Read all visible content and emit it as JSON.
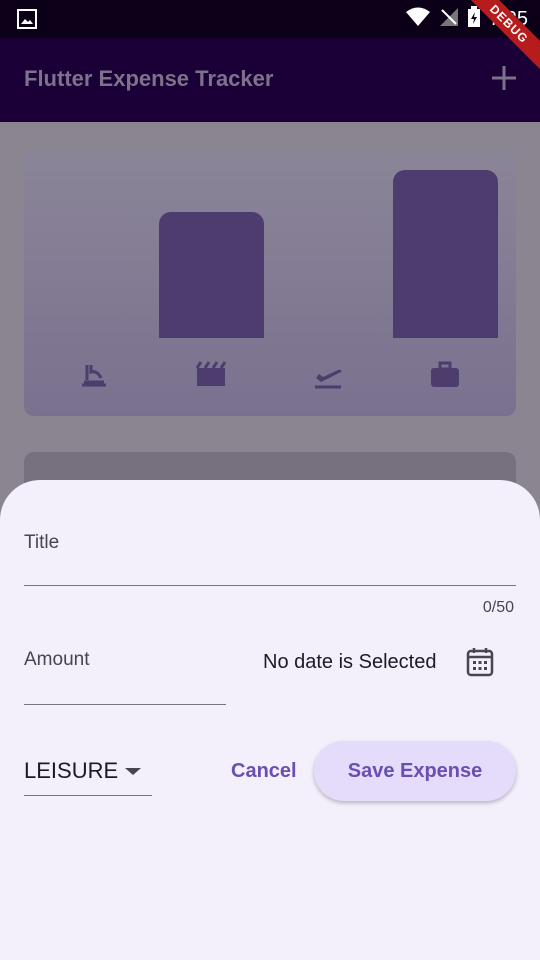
{
  "status_bar": {
    "time": "7:25",
    "debug_label": "DEBUG"
  },
  "app_bar": {
    "title": "Flutter Expense Tracker",
    "add_icon": "plus-icon"
  },
  "chart": {
    "bars": [
      {
        "category": "food",
        "fill": 0.0
      },
      {
        "category": "leisure",
        "fill": 0.75
      },
      {
        "category": "travel",
        "fill": 0.0
      },
      {
        "category": "work",
        "fill": 1.0
      }
    ],
    "icons": [
      "lunch-dining-icon",
      "movie-icon",
      "flight-takeoff-icon",
      "work-icon"
    ]
  },
  "form": {
    "title_label": "Title",
    "title_counter": "0/50",
    "amount_label": "Amount",
    "date_text": "No date is Selected",
    "calendar_icon": "calendar-icon",
    "category_value": "LEISURE",
    "cancel_label": "Cancel",
    "save_label": "Save Expense"
  },
  "colors": {
    "accent": "#6a4fb3",
    "sheet_bg": "#f3effb",
    "bar": "#4d3c6e",
    "appbar": "#1a0036"
  }
}
